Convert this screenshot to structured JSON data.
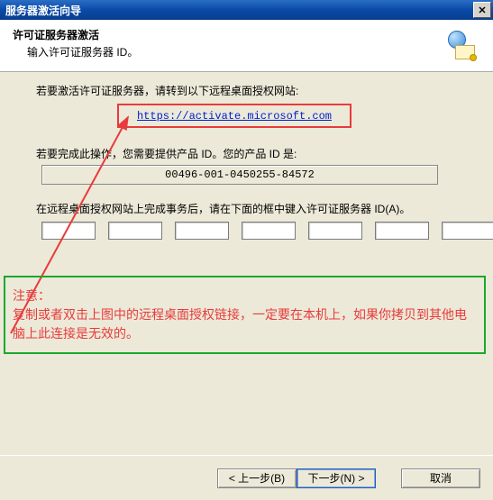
{
  "titlebar": {
    "text": "服务器激活向导"
  },
  "header": {
    "title": "许可证服务器激活",
    "subtitle": "输入许可证服务器 ID。"
  },
  "content": {
    "instr1": "若要激活许可证服务器，请转到以下远程桌面授权网站:",
    "link": "https://activate.microsoft.com",
    "instr2": "若要完成此操作，您需要提供产品 ID。您的产品 ID 是:",
    "product_id": "00496-001-0450255-84572",
    "instr3": "在远程桌面授权网站上完成事务后，请在下面的框中键入许可证服务器 ID(A)。",
    "inputs": [
      "",
      "",
      "",
      "",
      "",
      "",
      ""
    ]
  },
  "note": {
    "title": "注意：",
    "body": "复制或者双击上图中的远程桌面授权链接，一定要在本机上，如果你拷贝到其他电脑上此连接是无效的。"
  },
  "footer": {
    "back": "< 上一步(B)",
    "next": "下一步(N) >",
    "cancel": "取消"
  },
  "colors": {
    "highlight_red": "#e83b3b",
    "highlight_green": "#1aa82e",
    "titlebar_blue": "#0a4aa8"
  }
}
